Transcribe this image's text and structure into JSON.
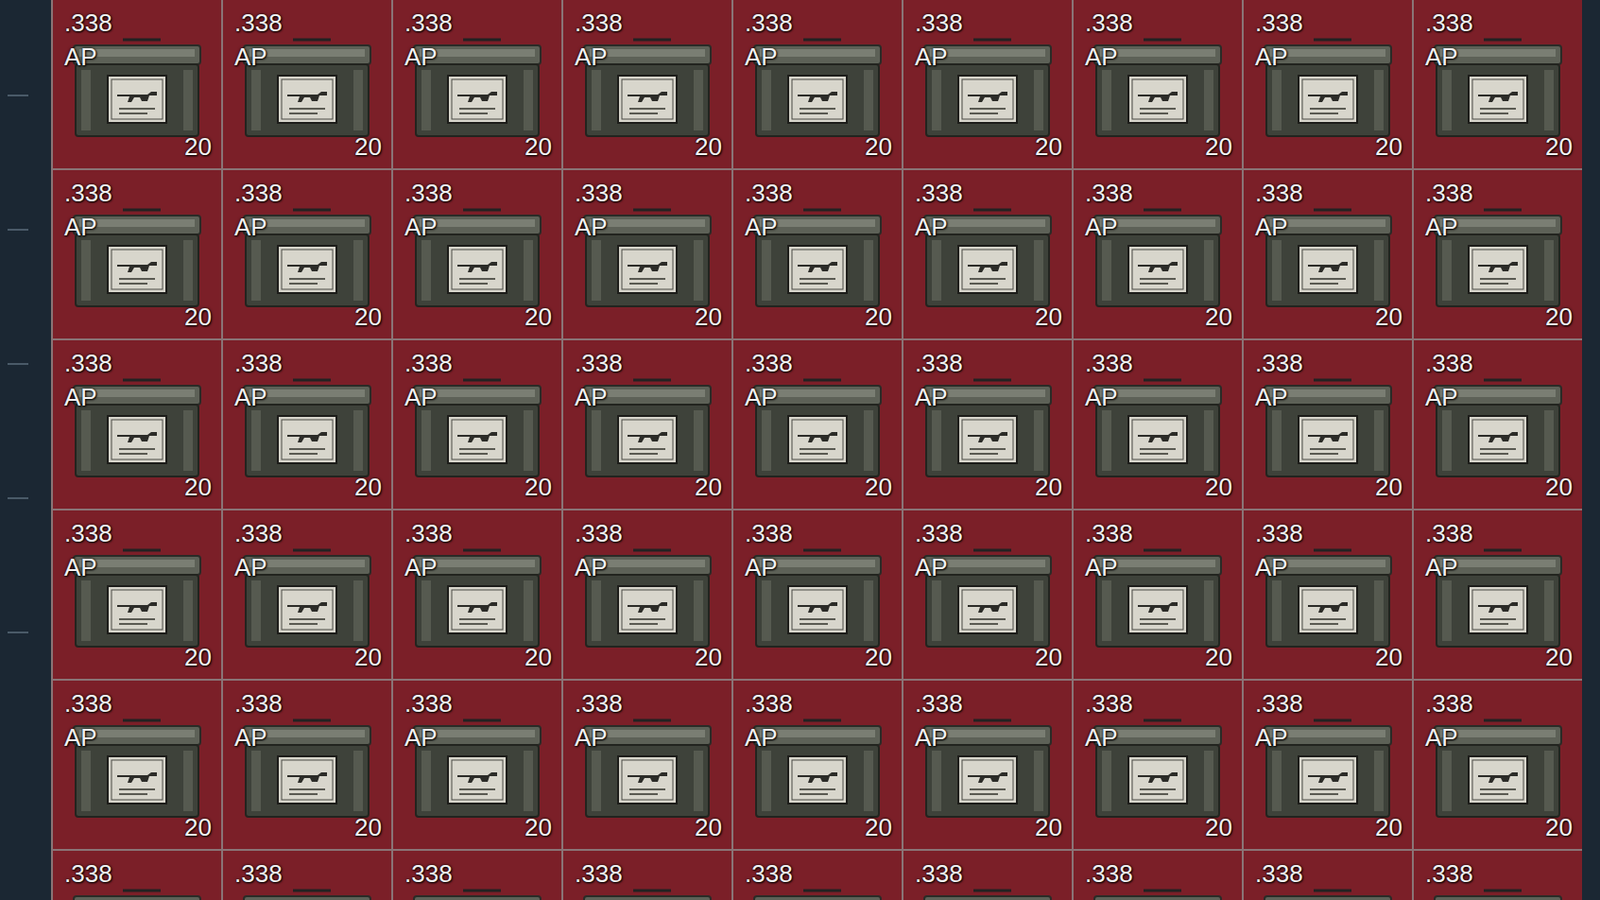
{
  "inventory": {
    "rows": [
      {
        "items": [
          {
            "caliber": ".338",
            "type": "AP",
            "count": "20"
          },
          {
            "caliber": ".338",
            "type": "AP",
            "count": "20"
          },
          {
            "caliber": ".338",
            "type": "AP",
            "count": "20"
          },
          {
            "caliber": ".338",
            "type": "AP",
            "count": "20"
          },
          {
            "caliber": ".338",
            "type": "AP",
            "count": "20"
          },
          {
            "caliber": ".338",
            "type": "AP",
            "count": "20"
          },
          {
            "caliber": ".338",
            "type": "AP",
            "count": "20"
          },
          {
            "caliber": ".338",
            "type": "AP",
            "count": "20"
          },
          {
            "caliber": ".338",
            "type": "AP",
            "count": "20"
          }
        ]
      },
      {
        "items": [
          {
            "caliber": ".338",
            "type": "AP",
            "count": "20"
          },
          {
            "caliber": ".338",
            "type": "AP",
            "count": "20"
          },
          {
            "caliber": ".338",
            "type": "AP",
            "count": "20"
          },
          {
            "caliber": ".338",
            "type": "AP",
            "count": "20"
          },
          {
            "caliber": ".338",
            "type": "AP",
            "count": "20"
          },
          {
            "caliber": ".338",
            "type": "AP",
            "count": "20"
          },
          {
            "caliber": ".338",
            "type": "AP",
            "count": "20"
          },
          {
            "caliber": ".338",
            "type": "AP",
            "count": "20"
          },
          {
            "caliber": ".338",
            "type": "AP",
            "count": "20"
          }
        ]
      },
      {
        "items": [
          {
            "caliber": ".338",
            "type": "AP",
            "count": "20"
          },
          {
            "caliber": ".338",
            "type": "AP",
            "count": "20"
          },
          {
            "caliber": ".338",
            "type": "AP",
            "count": "20"
          },
          {
            "caliber": ".338",
            "type": "AP",
            "count": "20"
          },
          {
            "caliber": ".338",
            "type": "AP",
            "count": "20"
          },
          {
            "caliber": ".338",
            "type": "AP",
            "count": "20"
          },
          {
            "caliber": ".338",
            "type": "AP",
            "count": "20"
          },
          {
            "caliber": ".338",
            "type": "AP",
            "count": "20"
          },
          {
            "caliber": ".338",
            "type": "AP",
            "count": "20"
          }
        ]
      },
      {
        "items": [
          {
            "caliber": ".338",
            "type": "AP",
            "count": "20"
          },
          {
            "caliber": ".338",
            "type": "AP",
            "count": "20"
          },
          {
            "caliber": ".338",
            "type": "AP",
            "count": "20"
          },
          {
            "caliber": ".338",
            "type": "AP",
            "count": "20"
          },
          {
            "caliber": ".338",
            "type": "AP",
            "count": "20"
          },
          {
            "caliber": ".338",
            "type": "AP",
            "count": "20"
          },
          {
            "caliber": ".338",
            "type": "AP",
            "count": "20"
          },
          {
            "caliber": ".338",
            "type": "AP",
            "count": "20"
          },
          {
            "caliber": ".338",
            "type": "AP",
            "count": "20"
          }
        ]
      },
      {
        "items": [
          {
            "caliber": ".338",
            "type": "AP",
            "count": "20"
          },
          {
            "caliber": ".338",
            "type": "AP",
            "count": "20"
          },
          {
            "caliber": ".338",
            "type": "AP",
            "count": "20"
          },
          {
            "caliber": ".338",
            "type": "AP",
            "count": "20"
          },
          {
            "caliber": ".338",
            "type": "AP",
            "count": "20"
          },
          {
            "caliber": ".338",
            "type": "AP",
            "count": "20"
          },
          {
            "caliber": ".338",
            "type": "AP",
            "count": "20"
          },
          {
            "caliber": ".338",
            "type": "AP",
            "count": "20"
          },
          {
            "caliber": ".338",
            "type": "AP",
            "count": "20"
          }
        ]
      },
      {
        "items": [
          {
            "caliber": ".338"
          },
          {
            "caliber": ".338"
          },
          {
            "caliber": ".338"
          },
          {
            "caliber": ".338"
          },
          {
            "caliber": ".338"
          },
          {
            "caliber": ".338"
          },
          {
            "caliber": ".338"
          },
          {
            "caliber": ".338"
          },
          {
            "caliber": ".338"
          }
        ]
      }
    ]
  }
}
